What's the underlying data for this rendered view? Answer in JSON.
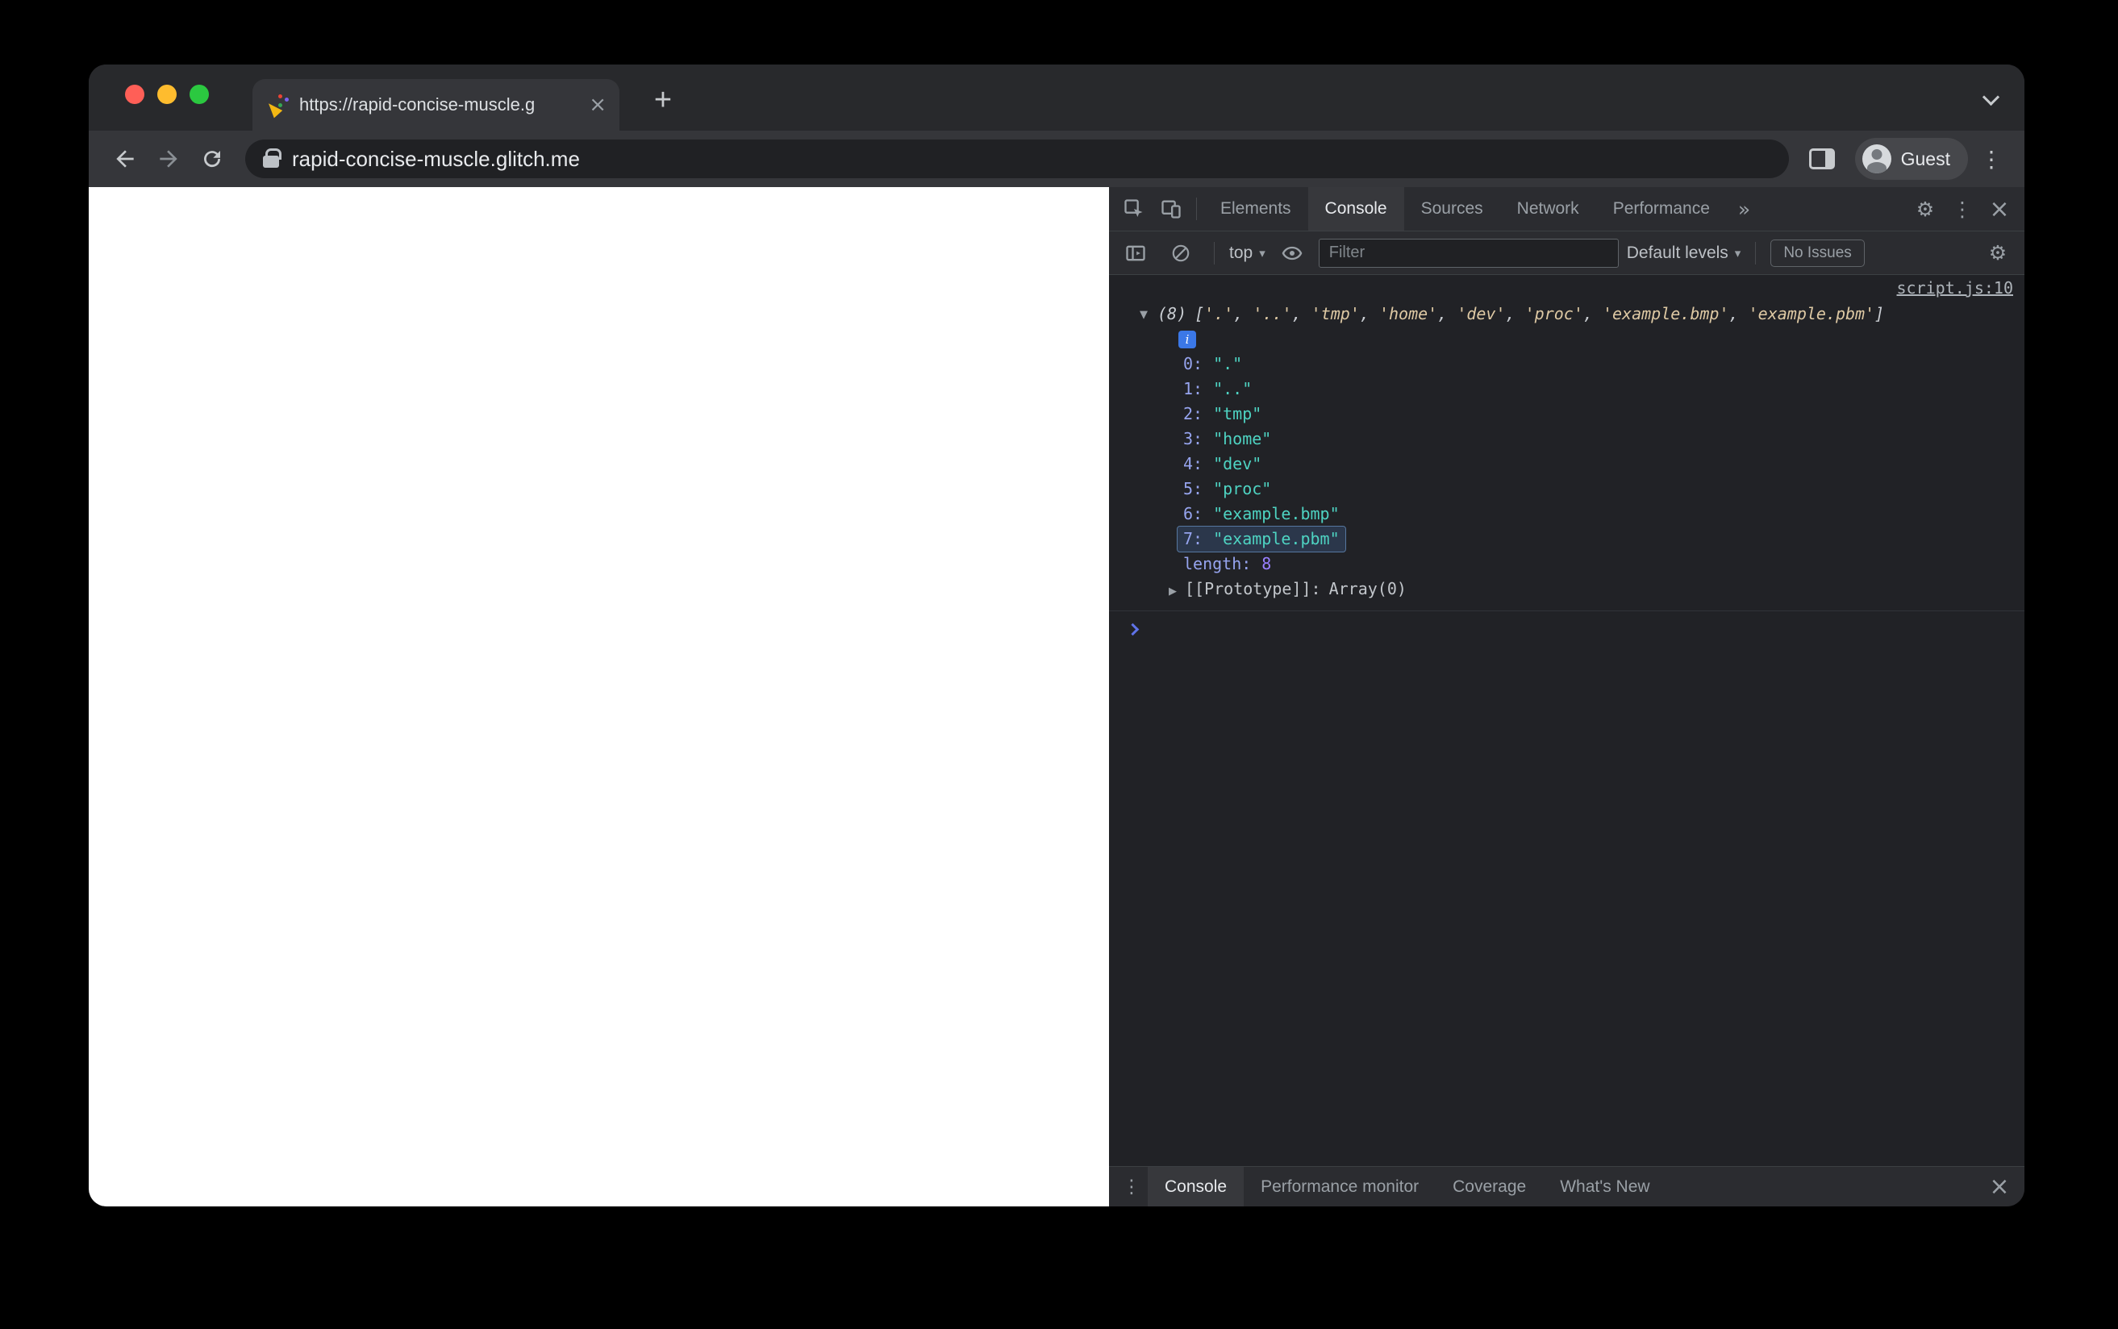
{
  "browser": {
    "tab": {
      "title": "https://rapid-concise-muscle.g"
    },
    "url": "rapid-concise-muscle.glitch.me",
    "profile_label": "Guest"
  },
  "icons": {
    "plus": "+",
    "close": "×",
    "tab_close": "×",
    "kebab": "⋮",
    "gear": "⚙",
    "more_tabs": "»",
    "caret_down": "▾",
    "expand_open": "▼",
    "expand_closed": "▶",
    "info": "i"
  },
  "devtools": {
    "main_tabs": [
      {
        "label": "Elements"
      },
      {
        "label": "Console",
        "active": true
      },
      {
        "label": "Sources"
      },
      {
        "label": "Network"
      },
      {
        "label": "Performance"
      }
    ],
    "toolbar": {
      "context": "top",
      "filter_placeholder": "Filter",
      "levels": "Default levels",
      "issues": "No Issues"
    },
    "console": {
      "source_link": "script.js:10",
      "count": "(8)",
      "bracket_open": "[",
      "bracket_close": "]",
      "items": [
        {
          "index_label": "0:",
          "preview": "'.'",
          "sep": ", ",
          "value": "\".\""
        },
        {
          "index_label": "1:",
          "preview": "'..'",
          "sep": ", ",
          "value": "\"..\""
        },
        {
          "index_label": "2:",
          "preview": "'tmp'",
          "sep": ", ",
          "value": "\"tmp\""
        },
        {
          "index_label": "3:",
          "preview": "'home'",
          "sep": ", ",
          "value": "\"home\""
        },
        {
          "index_label": "4:",
          "preview": "'dev'",
          "sep": ", ",
          "value": "\"dev\""
        },
        {
          "index_label": "5:",
          "preview": "'proc'",
          "sep": ", ",
          "value": "\"proc\""
        },
        {
          "index_label": "6:",
          "preview": "'example.bmp'",
          "sep": ", ",
          "value": "\"example.bmp\""
        },
        {
          "index_label": "7:",
          "preview": "'example.pbm'",
          "sep": "",
          "value": "\"example.pbm\"",
          "highlighted": true
        }
      ],
      "length_label": "length:",
      "length_value": "8",
      "proto_label": "[[Prototype]]:",
      "proto_value": "Array(0)"
    },
    "drawer_tabs": [
      {
        "label": "Console",
        "active": true
      },
      {
        "label": "Performance monitor"
      },
      {
        "label": "Coverage"
      },
      {
        "label": "What's New"
      }
    ]
  },
  "colors": {
    "string_teal": "#4ED3C2",
    "index_blue": "#96A4EE",
    "number_violet": "#9980FF",
    "prompt_blue": "#5F73E8",
    "info_badge_blue": "#3B78E7",
    "traffic_red": "#FF5F57",
    "traffic_yellow": "#FEBC2E",
    "traffic_green": "#2BC840"
  }
}
